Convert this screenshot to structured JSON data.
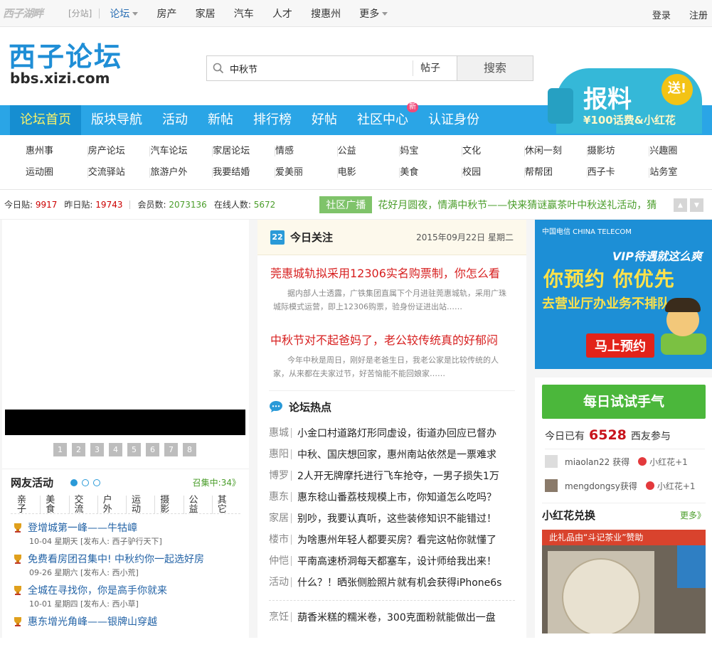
{
  "topbar": {
    "mini_logo": "西子湖畔",
    "fenzhan": "[分站]",
    "nav": [
      "论坛",
      "房产",
      "家居",
      "汽车",
      "人才",
      "搜惠州",
      "更多"
    ],
    "login": "登录",
    "register": "注册"
  },
  "header": {
    "logo_cn": "西子论坛",
    "logo_url": "bbs.xizi.com",
    "search_value": "中秋节",
    "search_type": "帖子",
    "search_button": "搜索",
    "ad_title": "报料",
    "ad_badge": "送!",
    "ad_sub": "¥100话费&小红花"
  },
  "mainnav": [
    "论坛首页",
    "版块导航",
    "活动",
    "新帖",
    "排行榜",
    "好帖",
    "社区中心",
    "认证身份"
  ],
  "mainnav_badge": "新",
  "subnav": {
    "row1": [
      "惠州事",
      "房产论坛",
      "汽车论坛",
      "家居论坛",
      "情感",
      "公益",
      "妈宝",
      "文化",
      "休闲一刻",
      "摄影坊",
      "兴趣圈"
    ],
    "row2": [
      "运动圈",
      "交流驿站",
      "旅游户外",
      "我要结婚",
      "爱美丽",
      "电影",
      "美食",
      "校园",
      "帮帮团",
      "西子卡",
      "站务室"
    ]
  },
  "stats": {
    "today_label": "今日贴:",
    "today_val": "9917",
    "yest_label": "昨日贴:",
    "yest_val": "19743",
    "member_label": "会员数:",
    "member_val": "2073136",
    "online_label": "在线人数:",
    "online_val": "5672",
    "broadcast_label": "社区广播",
    "broadcast_text": "花好月圆夜，情满中秋节——快来猜谜赢茶叶中秋送礼活动，猜"
  },
  "slider_pages": [
    "1",
    "2",
    "3",
    "4",
    "5",
    "6",
    "7",
    "8"
  ],
  "activity": {
    "title": "网友活动",
    "more": "召集中:34》",
    "tags": [
      "亲子",
      "美食",
      "交流",
      "户外",
      "运动",
      "摄影",
      "公益",
      "其它"
    ],
    "items": [
      {
        "title": "登增城第一峰——牛牯嶂",
        "meta": "10-04 星期天 [发布人: 西子驴行天下]"
      },
      {
        "title": "免费看房团召集中! 中秋约你一起选好房",
        "meta": "09-26 星期六 [发布人: 西小荒]"
      },
      {
        "title": "全城在寻找你，你是高手你就来",
        "meta": "10-01 星期四 [发布人: 西小草]"
      },
      {
        "title": "惠东增光角峰——银牌山穿越",
        "meta": ""
      }
    ]
  },
  "today": {
    "cal": "22",
    "label": "今日关注",
    "date": "2015年09月22日 星期二",
    "news": [
      {
        "h": "莞惠城轨拟采用12306实名购票制，你怎么看",
        "p": "据内部人士透露，广铁集团直属下个月进驻莞惠城轨，采用广珠城际模式运营，即上12306购票，验身份证进出站……"
      },
      {
        "h": "中秋节对不起爸妈了，老公较传统真的好郁闷",
        "p": "今年中秋是周日，刚好是老爸生日，我老公家是比较传统的人家，从来都在夫家过节，好苦恼能不能回娘家……"
      }
    ]
  },
  "hot": {
    "label": "论坛热点",
    "rows": [
      {
        "area": "惠城",
        "txt": "小金口村道路灯形同虚设，街道办回应已督办"
      },
      {
        "area": "惠阳",
        "txt": "中秋、国庆想回家，惠州南站依然是一票难求"
      },
      {
        "area": "博罗",
        "txt": "2人开无牌摩托进行飞车抢夺，一男子损失1万"
      },
      {
        "area": "惠东",
        "txt": "惠东稔山番荔枝规模上市，你知道怎么吃吗？"
      },
      {
        "area": "家居",
        "txt": "别吵，我要认真听，这些装修知识不能错过！"
      },
      {
        "area": "楼市",
        "txt": "为啥惠州年轻人都要买房？看完这帖你就懂了"
      },
      {
        "area": "仲恺",
        "txt": "平南高速桥洞每天都塞车，设计师给我出来！"
      },
      {
        "area": "活动",
        "txt": "什么？！晒张侧脸照片就有机会获得iPhone6s"
      }
    ],
    "last": {
      "area": "烹饪",
      "txt": "葫香米糕的糯米卷，300克面粉就能做出一盘"
    }
  },
  "ad_tel": {
    "logo": "中国电信 CHINA TELECOM",
    "vip": "VIP待遇就这么爽",
    "big": "你预约 你优先",
    "mid": "去营业厅办业务不排队",
    "cta": "马上预约"
  },
  "trial": {
    "button": "每日试试手气",
    "count_pre": "今日已有",
    "count": "6528",
    "count_post": "西友参与",
    "winners": [
      {
        "name": "miaolan22 获得",
        "prize": "小红花+1"
      },
      {
        "name": "mengdongsy获得",
        "prize": "小红花+1"
      }
    ],
    "exchange_label": "小红花兑换",
    "exchange_more": "更多》",
    "exchange_caption": "此礼品由“斗记茶业”赞助"
  }
}
